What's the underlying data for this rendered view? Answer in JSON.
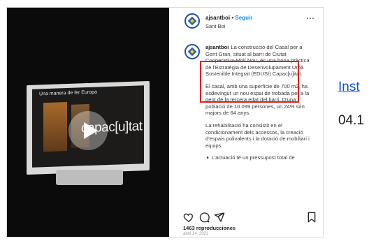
{
  "post": {
    "media": {
      "screen_heading": "Una manera de fer Europa",
      "screen_word": "capac[u]tat"
    },
    "header": {
      "username": "ajsantboi",
      "separator": "•",
      "follow_label": "Seguir",
      "location": "Sant Boi",
      "more_icon": "more-horizontal-icon"
    },
    "caption": {
      "username": "ajsantboi",
      "paragraphs": [
        "La construcció del Casal per a Gent Gran, situat al barri de Ciutat Cooperativa-Molí Nou, és una bona pràctica de l'Estratègia de Desenvolupament Urbà Sostenible Integrat (EDUSI) Capac[u]itat.",
        "El casal, amb una superfície de 700 m2, ha esdevingut un nou espai de trobada per a la gent de la tercera edat del barri. D'una població de 10.099 persones, un 24% són majors de 64 anys.",
        "La rehabilitació ha consistit en el condicionament dels accessos, la creació d'espais polivalents i la dotació de mobiliari i equips.",
        "➧ L'actuació té un pressupost total de"
      ]
    },
    "actions": {
      "icons": [
        "heart-icon",
        "comment-icon",
        "share-icon",
        "bookmark-icon"
      ]
    },
    "views": "1463 reproducciones",
    "date": "abril 14, 2021"
  },
  "external": {
    "link_text": "Inst",
    "date_text": "04.1"
  },
  "colors": {
    "highlight_border": "#e02020",
    "follow": "#0095f6",
    "link": "#0b57d0"
  }
}
